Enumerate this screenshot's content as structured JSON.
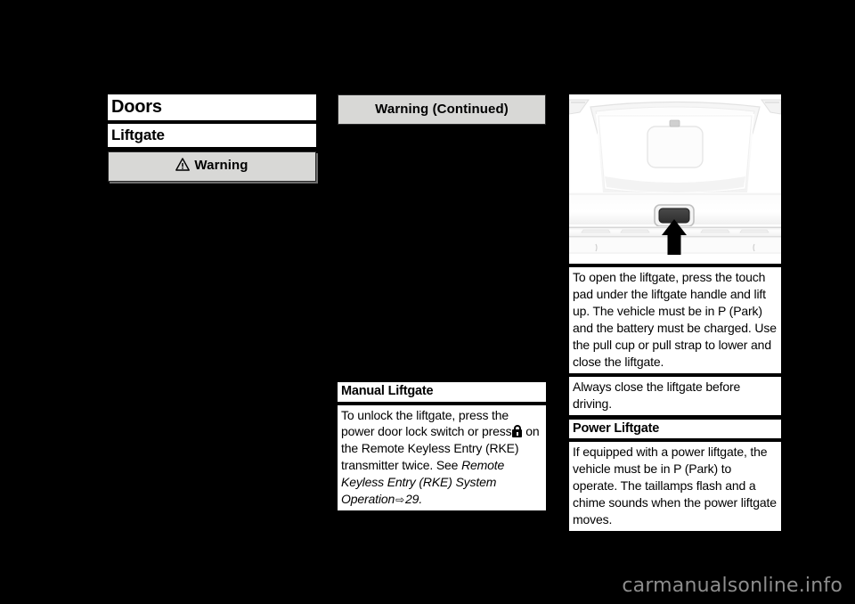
{
  "page": {
    "background_color": "#000000",
    "watermark": "carmanualsonline.info"
  },
  "left_column": {
    "section_title": "Doors",
    "subsection_title": "Liftgate",
    "warning_banner": {
      "label": "Warning",
      "icon": "warning-triangle-icon",
      "fill_color": "#d8d8d6"
    }
  },
  "middle_column": {
    "warning_continued": {
      "label": "Warning  (Continued)",
      "fill_color": "#d8d8d6"
    },
    "manual_liftgate": {
      "heading": "Manual Liftgate",
      "text_part1": "To unlock the liftgate, press the power door lock switch or press",
      "inline_icon": "unlock-padlock-icon",
      "text_part2": "on the Remote Keyless Entry (RKE) transmitter twice. See",
      "reference_italic": "Remote Keyless Entry (RKE) System Operation",
      "reference_arrow": "⇨",
      "reference_page": "29."
    }
  },
  "right_column": {
    "illustration": {
      "name": "liftgate-touch-pad-illustration",
      "callout_arrow": "up-arrow-pointing-to-touch-pad"
    },
    "open_instructions": "To open the liftgate, press the touch pad under the liftgate handle and lift up. The vehicle must be in P (Park) and the battery must be charged. Use the pull cup or pull strap to lower and close the liftgate.",
    "close_note": "Always close the liftgate before driving.",
    "power_liftgate": {
      "heading": "Power Liftgate",
      "text": "If equipped with a power liftgate, the vehicle must be in P (Park) to operate. The taillamps flash and a chime sounds when the power liftgate moves."
    }
  }
}
